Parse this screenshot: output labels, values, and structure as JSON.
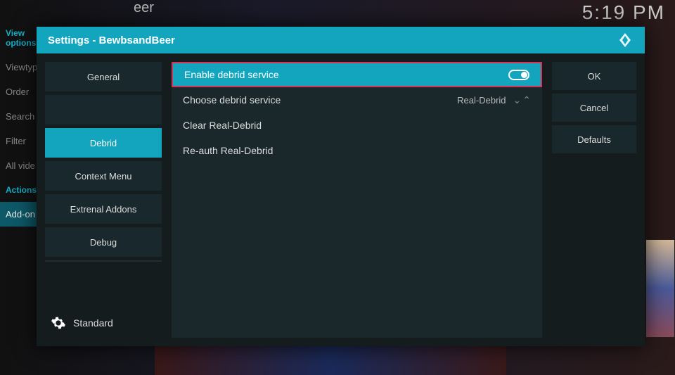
{
  "background": {
    "header_fragment": "eer",
    "clock": "5:19 PM",
    "sidebar": {
      "section1_title": "View options",
      "items1": [
        "Viewtyp",
        "Order",
        "Search",
        "Filter",
        "All vide"
      ],
      "section2_title": "Actions",
      "items2": [
        "Add-on"
      ]
    }
  },
  "dialog": {
    "title": "Settings - BewbsandBeer",
    "categories": [
      {
        "label": "General",
        "selected": false
      },
      {
        "label": "",
        "selected": false,
        "empty": true
      },
      {
        "label": "Debrid",
        "selected": true
      },
      {
        "label": "Context Menu",
        "selected": false
      },
      {
        "label": "Extrenal Addons",
        "selected": false
      },
      {
        "label": "Debug",
        "selected": false
      }
    ],
    "level": "Standard",
    "options": {
      "enable_debrid": {
        "label": "Enable debrid service",
        "on": true
      },
      "choose_debrid": {
        "label": "Choose debrid service",
        "value": "Real-Debrid"
      },
      "clear_rd": {
        "label": "Clear Real-Debrid"
      },
      "reauth_rd": {
        "label": "Re-auth Real-Debrid"
      }
    },
    "actions": {
      "ok": "OK",
      "cancel": "Cancel",
      "defaults": "Defaults"
    }
  }
}
